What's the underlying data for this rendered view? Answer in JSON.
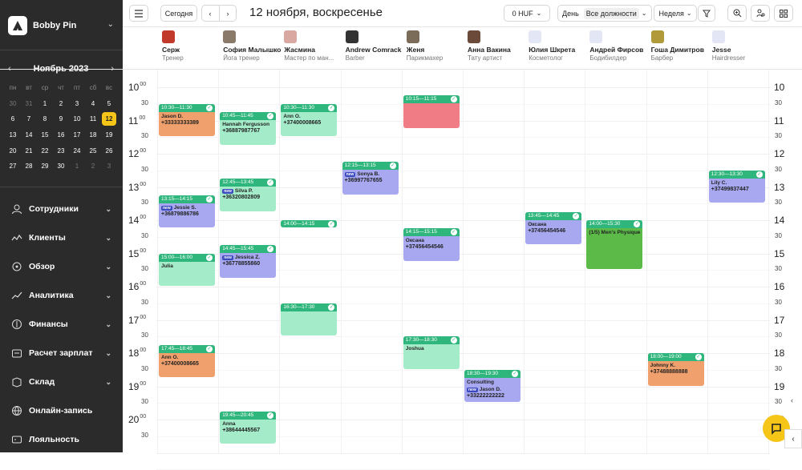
{
  "brand": {
    "name": "Bobby Pin"
  },
  "mini_calendar": {
    "title": "Ноябрь 2023",
    "weekdays": [
      "пн",
      "вт",
      "ср",
      "чт",
      "пт",
      "сб",
      "вс"
    ],
    "days": [
      [
        "30",
        "31",
        "1",
        "2",
        "3",
        "4",
        "5"
      ],
      [
        "6",
        "7",
        "8",
        "9",
        "10",
        "11",
        "12"
      ],
      [
        "13",
        "14",
        "15",
        "16",
        "17",
        "18",
        "19"
      ],
      [
        "20",
        "21",
        "22",
        "23",
        "24",
        "25",
        "26"
      ],
      [
        "27",
        "28",
        "29",
        "30",
        "1",
        "2",
        "3"
      ]
    ],
    "selected": "12"
  },
  "menu": [
    {
      "label": "Сотрудники",
      "icon": "people-icon"
    },
    {
      "label": "Клиенты",
      "icon": "clients-icon"
    },
    {
      "label": "Обзор",
      "icon": "overview-icon"
    },
    {
      "label": "Аналитика",
      "icon": "analytics-icon"
    },
    {
      "label": "Финансы",
      "icon": "finance-icon"
    },
    {
      "label": "Расчет зарплат",
      "icon": "payroll-icon"
    },
    {
      "label": "Склад",
      "icon": "warehouse-icon"
    },
    {
      "label": "Онлайн-запись",
      "icon": "globe-icon"
    },
    {
      "label": "Лояльность",
      "icon": "loyalty-icon"
    }
  ],
  "toolbar": {
    "today": "Сегодня",
    "date_title": "12 ноября, воскресенье",
    "currency": "0 HUF",
    "view_day": "День",
    "position_filter": "Все должности",
    "view_week": "Неделя"
  },
  "staff": [
    {
      "name": "Серж",
      "role": "Тренер",
      "avatar": "#c0392b"
    },
    {
      "name": "София Малышко",
      "role": "Йога тренер",
      "avatar": "#8a7a6a"
    },
    {
      "name": "Жасмина",
      "role": "Мастер по ман...",
      "avatar": "#d9a8a0"
    },
    {
      "name": "Andrew Comrack",
      "role": "Barber",
      "avatar": "#333333"
    },
    {
      "name": "Женя",
      "role": "Парикмахер",
      "avatar": "#7b6c5a"
    },
    {
      "name": "Анна Вакина",
      "role": "Тату артист",
      "avatar": "#6b4a3a"
    },
    {
      "name": "Юлия Шкрета",
      "role": "Косметолог",
      "avatar": "#e3e6f5"
    },
    {
      "name": "Андрей Фирсов",
      "role": "Бодибилдер",
      "avatar": "#e3e6f5"
    },
    {
      "name": "Гоша Димитров",
      "role": "Барбер",
      "avatar": "#b09a3a"
    },
    {
      "name": "Jesse",
      "role": "Hairdresser",
      "avatar": "#e3e6f5"
    }
  ],
  "hours": [
    "10",
    "11",
    "12",
    "13",
    "14",
    "15",
    "16",
    "17",
    "18",
    "19",
    "20"
  ],
  "minute_labels": {
    "zero": "00",
    "half": "30"
  },
  "events": [
    {
      "col": 0,
      "start": 10.5,
      "end": 11.5,
      "time": "10:30—11:30",
      "name": "Jason D.",
      "phone": "+33333333389",
      "color": "orange",
      "new": false
    },
    {
      "col": 0,
      "start": 13.25,
      "end": 14.25,
      "time": "13:15—14:15",
      "name": "Jessie S.",
      "phone": "+36879886786",
      "color": "blue",
      "new": true
    },
    {
      "col": 0,
      "start": 15.0,
      "end": 16.0,
      "time": "15:00—16:00",
      "name": "Julia",
      "phone": "",
      "color": "green",
      "new": false
    },
    {
      "col": 0,
      "start": 17.75,
      "end": 18.75,
      "time": "17:45—18:45",
      "name": "Ann O.",
      "phone": "+37400008665",
      "color": "orange",
      "new": false
    },
    {
      "col": 1,
      "start": 10.75,
      "end": 11.75,
      "time": "10:45—11:45",
      "name": "Hannah Fergusson",
      "phone": "+36887987767",
      "color": "green",
      "new": false
    },
    {
      "col": 1,
      "start": 12.75,
      "end": 13.75,
      "time": "12:45—13:45",
      "name": "Silva P.",
      "phone": "+36320802809",
      "color": "green",
      "new": true
    },
    {
      "col": 1,
      "start": 14.75,
      "end": 15.75,
      "time": "14:45—15:45",
      "name": "Jessica Z.",
      "phone": "+36778855860",
      "color": "blue",
      "new": true
    },
    {
      "col": 1,
      "start": 19.75,
      "end": 20.75,
      "time": "19:45—20:45",
      "name": "Anna",
      "phone": "+38644445567",
      "color": "green",
      "new": false
    },
    {
      "col": 2,
      "start": 10.5,
      "end": 11.5,
      "time": "10:30—11:30",
      "name": "Ann O.",
      "phone": "+37400008665",
      "color": "green",
      "new": false
    },
    {
      "col": 2,
      "start": 14.0,
      "end": 14.25,
      "time": "14:00—14:15",
      "name": "",
      "phone": "",
      "color": "green",
      "new": false
    },
    {
      "col": 2,
      "start": 16.5,
      "end": 17.5,
      "time": "16:30—17:30",
      "name": "",
      "phone": "",
      "color": "green",
      "new": false
    },
    {
      "col": 3,
      "start": 12.25,
      "end": 13.25,
      "time": "12:15—13:15",
      "name": "Sonya B.",
      "phone": "+36997767655",
      "color": "blue",
      "new": true
    },
    {
      "col": 4,
      "start": 10.25,
      "end": 11.25,
      "time": "10:15—11:15",
      "name": "",
      "phone": "",
      "color": "red",
      "new": false
    },
    {
      "col": 4,
      "start": 14.25,
      "end": 15.25,
      "time": "14:15—15:15",
      "name": "Оксана",
      "phone": "+37456454546",
      "color": "blue",
      "new": false
    },
    {
      "col": 4,
      "start": 17.5,
      "end": 18.5,
      "time": "17:30—18:30",
      "name": "Joshua",
      "phone": "",
      "color": "green",
      "new": false
    },
    {
      "col": 5,
      "start": 18.5,
      "end": 19.5,
      "time": "18:30—19:30",
      "name": "Consulting",
      "name2": "Jason D.",
      "phone": "+33222222222",
      "color": "blue",
      "new": true
    },
    {
      "col": 6,
      "start": 13.75,
      "end": 14.75,
      "time": "13:45—14:45",
      "name": "Оксана",
      "phone": "+37456454546",
      "color": "blue",
      "new": false
    },
    {
      "col": 7,
      "start": 14.0,
      "end": 15.5,
      "time": "14:00—15:30",
      "name": "(1/5) Men's Physique",
      "phone": "",
      "color": "dgreen",
      "new": false
    },
    {
      "col": 8,
      "start": 18.0,
      "end": 19.0,
      "time": "18:00—19:00",
      "name": "Johnny K.",
      "phone": "+37488888888",
      "color": "orange",
      "new": false
    },
    {
      "col": 9,
      "start": 12.5,
      "end": 13.5,
      "time": "12:30—13:30",
      "name": "Lily C.",
      "phone": "+37499837447",
      "color": "blue",
      "new": false
    }
  ],
  "new_badge": "new",
  "colors": {
    "sidebar": "#2b2b2b",
    "accent": "#f5c518",
    "event_header": "#2fb67c",
    "orange": "#f0a06c",
    "green": "#a4ecc9",
    "blue": "#a7a8f0",
    "red": "#f07c85",
    "dgreen": "#5cbb48"
  }
}
